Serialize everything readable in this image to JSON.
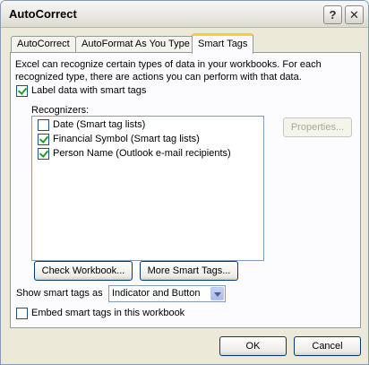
{
  "window": {
    "title": "AutoCorrect",
    "help_glyph": "?",
    "close_glyph": "✕"
  },
  "tabs": [
    {
      "label": "AutoCorrect",
      "selected": false
    },
    {
      "label": "AutoFormat As You Type",
      "selected": false
    },
    {
      "label": "Smart Tags",
      "selected": true
    }
  ],
  "smart_tags": {
    "description": "Excel can recognize certain types of data in your workbooks.  For each recognized type, there are actions you can perform with that data.",
    "label_checkbox": {
      "label": "Label data with smart tags",
      "checked": true
    },
    "recognizers_label": "Recognizers:",
    "recognizers": [
      {
        "label": "Date (Smart tag lists)",
        "checked": false
      },
      {
        "label": "Financial Symbol (Smart tag lists)",
        "checked": true
      },
      {
        "label": "Person Name (Outlook e-mail recipients)",
        "checked": true
      }
    ],
    "properties_label": "Properties...",
    "check_workbook_label": "Check Workbook...",
    "more_smart_tags_label": "More Smart Tags...",
    "show_as_label": "Show smart tags as",
    "show_as_value": "Indicator and Button",
    "embed_checkbox": {
      "label": "Embed smart tags in this workbook",
      "checked": false
    }
  },
  "footer": {
    "ok_label": "OK",
    "cancel_label": "Cancel"
  },
  "colors": {
    "dialog_bg": "#ece9d8",
    "active_tab_accent": "#ffc83c",
    "check_mark": "#21a121"
  }
}
